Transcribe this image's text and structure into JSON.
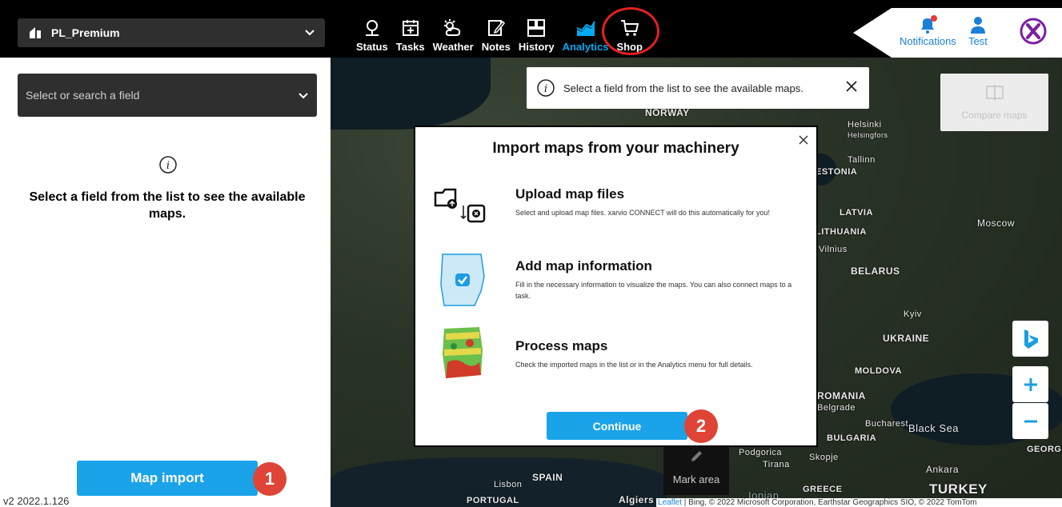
{
  "header": {
    "farm_name": "PL_Premium",
    "nav": [
      {
        "label": "Status",
        "icon": "status-pin-icon"
      },
      {
        "label": "Tasks",
        "icon": "tasks-icon"
      },
      {
        "label": "Weather",
        "icon": "weather-icon"
      },
      {
        "label": "Notes",
        "icon": "notes-icon"
      },
      {
        "label": "History",
        "icon": "history-icon"
      },
      {
        "label": "Analytics",
        "icon": "analytics-icon",
        "active": true
      },
      {
        "label": "Shop",
        "icon": "shop-cart-icon"
      }
    ],
    "notifications_label": "Notifications",
    "user_label": "Test"
  },
  "left_panel": {
    "field_placeholder": "Select or search a field",
    "message": "Select a field from the list to see the available maps.",
    "map_import_label": "Map import",
    "badge_1": "1",
    "version": "v2 2022.1.126"
  },
  "toast": {
    "message": "Select a field from the list to see the available maps."
  },
  "compare_label": "Compare maps",
  "mark_area_label": "Mark area",
  "dialog": {
    "title": "Import maps from your machinery",
    "steps": [
      {
        "title": "Upload map files",
        "desc": "Select and upload map files. xarvio CONNECT will do this automatically for you!"
      },
      {
        "title": "Add map information",
        "desc": "Fill in the necessary information to visualize the maps. You can also connect maps to a task."
      },
      {
        "title": "Process maps",
        "desc": "Check the imported maps in the list or in the Analytics menu for full details."
      }
    ],
    "continue_label": "Continue",
    "badge_2": "2"
  },
  "map_labels": [
    "NORWAY",
    "Helsinki",
    "Helsingfors",
    "Tallinn",
    "ESTONIA",
    "LATVIA",
    "LITHUANIA",
    "Vilnius",
    "BELARUS",
    "Moscow",
    "Kyiv",
    "UKRAINE",
    "MOLDOVA",
    "ROMANIA",
    "Belgrade",
    "Bucharest",
    "Black Sea",
    "BULGARIA",
    "Podgorica",
    "Tirana",
    "Skopje",
    "Ankara",
    "GREECE",
    "TURKEY",
    "SPAIN",
    "Lisbon",
    "PORTUGAL",
    "Algiers",
    "Ionian",
    "GEORGIA"
  ],
  "attribution": {
    "leaflet": "Leaflet",
    "rest": " | Bing, © 2022 Microsoft Corporation, Earthstar Geographics SIO, © 2022 TomTom"
  },
  "colors": {
    "accent": "#1aa3e8",
    "badge": "#e04436",
    "ring": "#e62020",
    "active_nav": "#00aaf0",
    "brand_purple": "#7b1fa2"
  }
}
